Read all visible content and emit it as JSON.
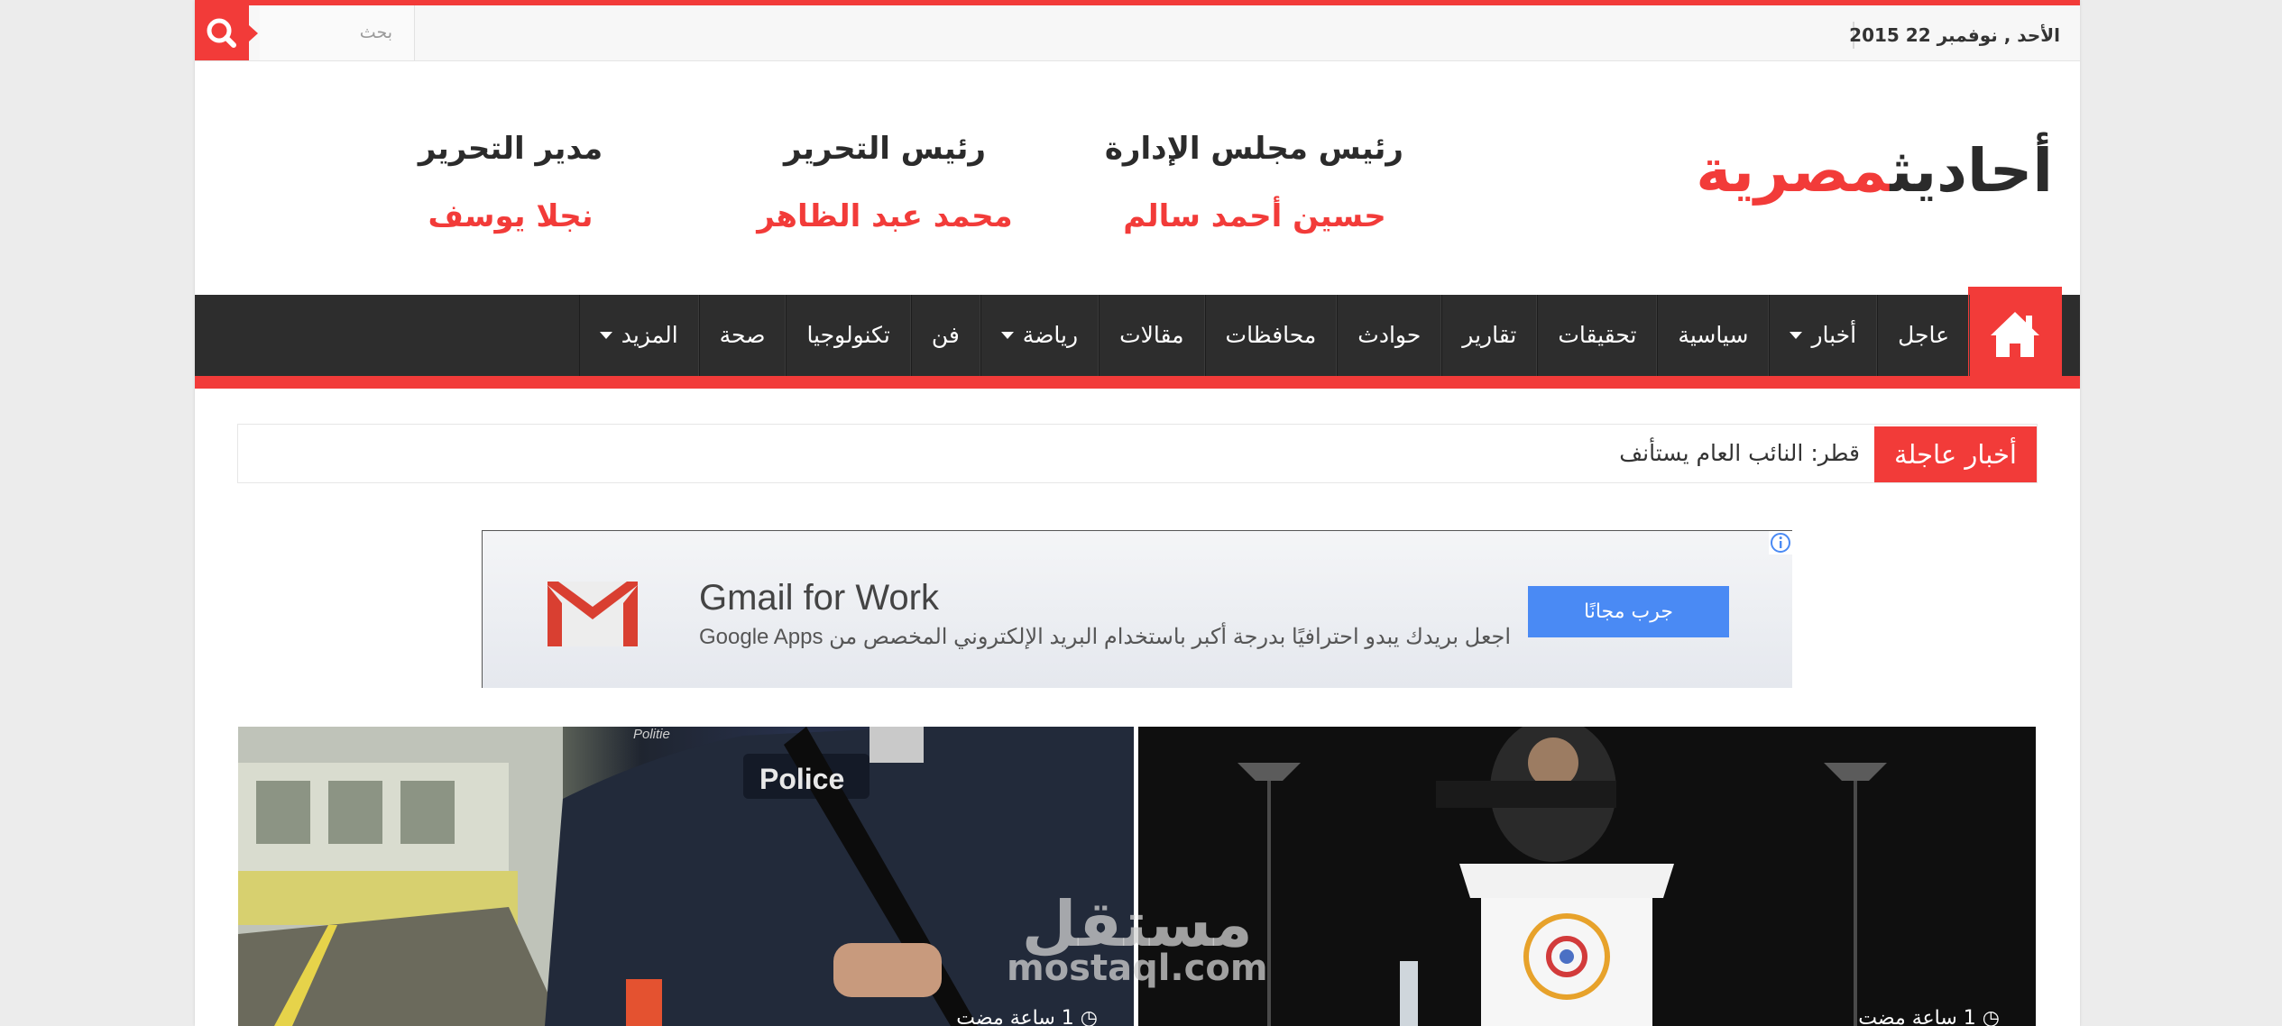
{
  "topbar": {
    "date": "الأحد , نوفمبر 22 2015",
    "search_placeholder": "بحث"
  },
  "logo": {
    "part1": "أحاديث",
    "part2": "مصرية"
  },
  "header_columns": [
    {
      "title": "رئيس مجلس الإدارة",
      "name": "حسين أحمد سالم"
    },
    {
      "title": "رئيس التحرير",
      "name": "محمد عبد الظاهر"
    },
    {
      "title": "مدير التحرير",
      "name": "نجلا يوسف"
    }
  ],
  "nav": {
    "items": [
      {
        "label": "عاجل",
        "dropdown": false
      },
      {
        "label": "أخبار",
        "dropdown": true
      },
      {
        "label": "سياسية",
        "dropdown": false
      },
      {
        "label": "تحقيقات",
        "dropdown": false
      },
      {
        "label": "تقارير",
        "dropdown": false
      },
      {
        "label": "حوادث",
        "dropdown": false
      },
      {
        "label": "محافظات",
        "dropdown": false
      },
      {
        "label": "مقالات",
        "dropdown": false
      },
      {
        "label": "رياضة",
        "dropdown": true
      },
      {
        "label": "فن",
        "dropdown": false
      },
      {
        "label": "تكنولوجيا",
        "dropdown": false
      },
      {
        "label": "صحة",
        "dropdown": false
      },
      {
        "label": "المزيد",
        "dropdown": true
      }
    ]
  },
  "breaking": {
    "label": "أخبار عاجلة",
    "text": "قطر: النائب العام يستأنف"
  },
  "ad": {
    "title": "Gmail for Work",
    "subtitle": "اجعل بريدك يبدو احترافيًا بدرجة أكبر باستخدام البريد الإلكتروني المخصص من Google Apps",
    "button": "جرب مجانًا"
  },
  "features": [
    {
      "time": "1 ساعة مضت",
      "image": "police-officer-train-station"
    },
    {
      "time": "1 ساعة مضت",
      "image": "speaker-at-podium"
    }
  ],
  "image_texts": {
    "police_vest": "Police",
    "politie_badge": "Politie"
  },
  "watermark": {
    "arabic": "مستقل",
    "latin": "mostaql.com"
  },
  "colors": {
    "accent": "#f23b39",
    "nav_bg": "#2d2d2d",
    "gmail_button": "#4a8af4"
  }
}
